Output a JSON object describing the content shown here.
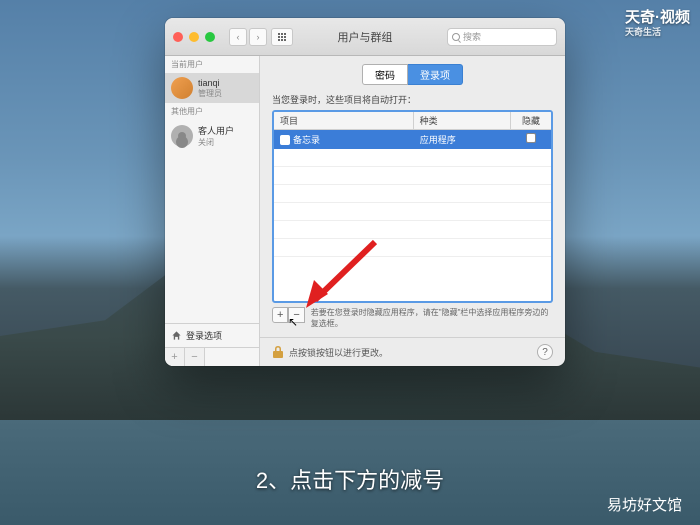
{
  "window": {
    "title": "用户与群组",
    "search_placeholder": "搜索"
  },
  "sidebar": {
    "current_user_label": "当前用户",
    "other_user_label": "其他用户",
    "users": [
      {
        "name": "tianqi",
        "role": "管理员"
      },
      {
        "name": "客人用户",
        "role": "关闭"
      }
    ],
    "login_options": "登录选项"
  },
  "tabs": {
    "password": "密码",
    "login_items": "登录项"
  },
  "main": {
    "description": "当您登录时，这些项目将自动打开：",
    "columns": {
      "item": "项目",
      "kind": "种类",
      "hide": "隐藏"
    },
    "rows": [
      {
        "name": "备忘录",
        "kind": "应用程序"
      }
    ],
    "hint": "若要在您登录时隐藏应用程序，请在\"隐藏\"栏中选择应用程序旁边的复选框。",
    "lock_text": "点按锁按钮以进行更改。"
  },
  "watermarks": {
    "top_right_main": "天奇·视频",
    "top_right_sub": "天奇生活",
    "bottom_right": "易坊好文馆"
  },
  "subtitle": "2、点击下方的减号"
}
